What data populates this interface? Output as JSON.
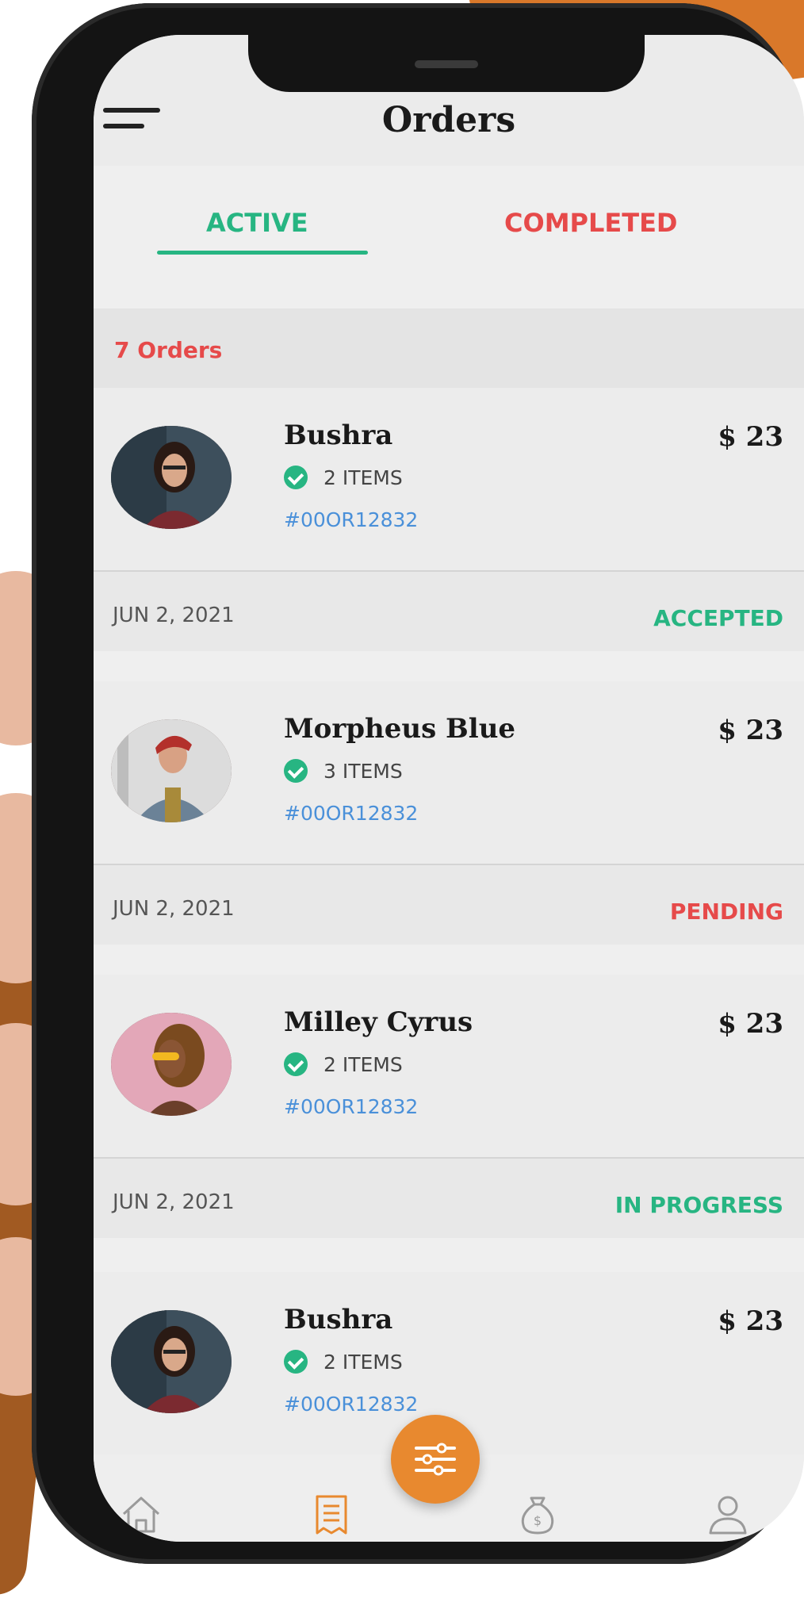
{
  "header": {
    "title": "Orders"
  },
  "tabs": [
    {
      "label": "ACTIVE",
      "active": true
    },
    {
      "label": "COMPLETED",
      "active": false
    }
  ],
  "orders_count": "7 Orders",
  "orders": [
    {
      "name": "Bushra",
      "price": "$ 23",
      "items": "2 ITEMS",
      "order_id": "#00OR12832",
      "date": "JUN 2, 2021",
      "status": "ACCEPTED"
    },
    {
      "name": "Morpheus Blue",
      "price": "$ 23",
      "items": "3 ITEMS",
      "order_id": "#00OR12832",
      "date": "JUN 2, 2021",
      "status": "PENDING"
    },
    {
      "name": "Milley Cyrus",
      "price": "$ 23",
      "items": "2 ITEMS",
      "order_id": "#00OR12832",
      "date": "JUN 2, 2021",
      "status": "IN PROGRESS"
    },
    {
      "name": "Bushra",
      "price": "$ 23",
      "items": "2 ITEMS",
      "order_id": "#00OR12832"
    }
  ],
  "bottom_nav": [
    {
      "icon": "home-icon"
    },
    {
      "icon": "orders-receipt-icon",
      "active": true
    },
    {
      "icon": "money-bag-icon"
    },
    {
      "icon": "user-icon"
    }
  ],
  "fab": {
    "icon": "sliders-filter-icon"
  },
  "colors": {
    "accent_green": "#27b582",
    "accent_red": "#e64a4a",
    "accent_orange": "#e8892f",
    "link_blue": "#4a90d9"
  }
}
